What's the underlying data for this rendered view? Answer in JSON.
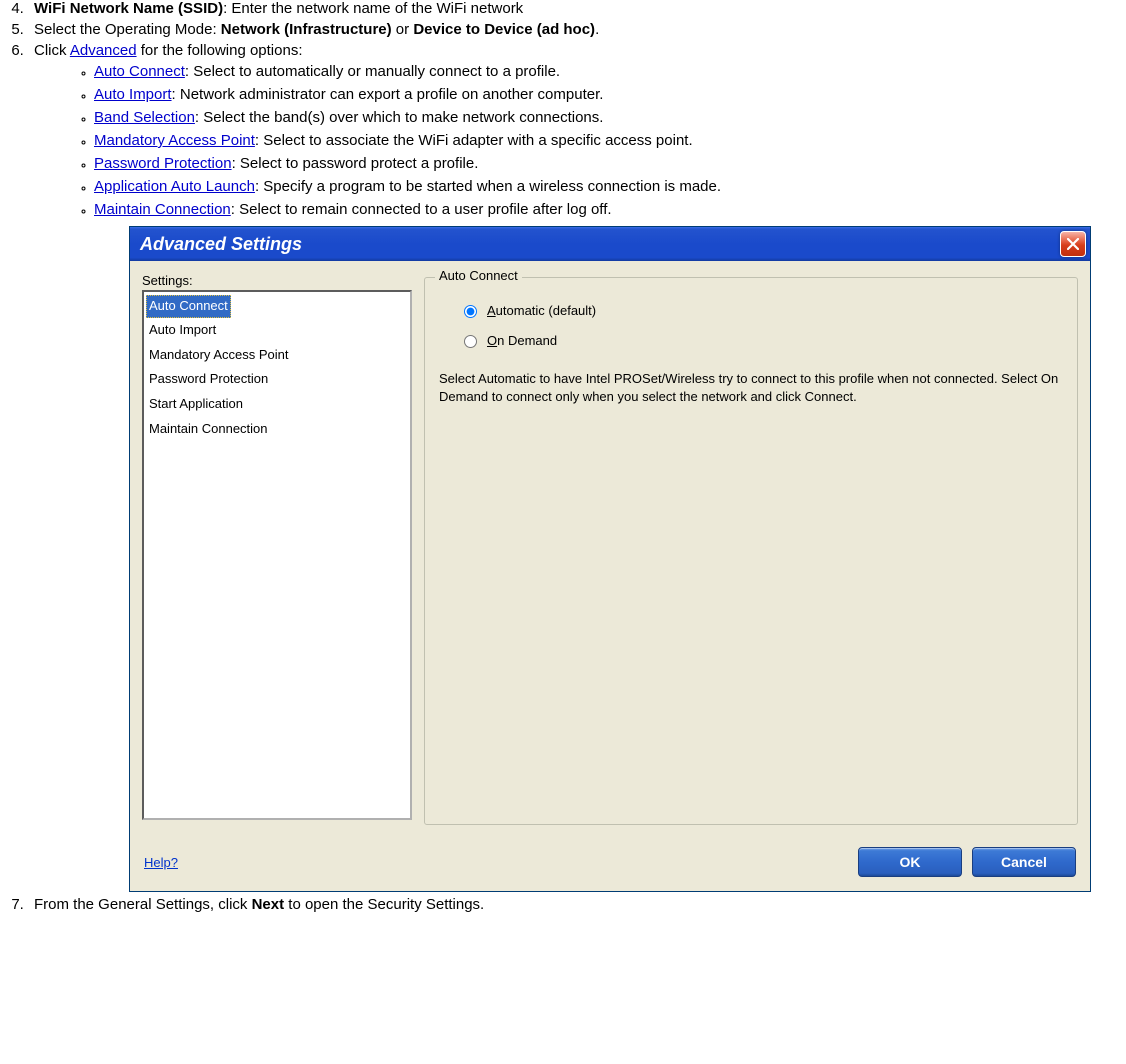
{
  "steps": {
    "s4": {
      "bold": "WiFi Network Name (SSID)",
      "rest": ": Enter the network name of the WiFi network"
    },
    "s5": {
      "pre": "Select the Operating Mode: ",
      "b1": "Network (Infrastructure)",
      "mid": " or ",
      "b2": "Device to Device (ad hoc)",
      "end": "."
    },
    "s6": {
      "pre": "Click ",
      "link": "Advanced",
      "post": " for the following options:"
    },
    "sub": {
      "a": {
        "link": "Auto Connect",
        "desc": ": Select to automatically or manually connect to a profile."
      },
      "b": {
        "link": "Auto Import",
        "desc": ": Network administrator can export a profile on another computer."
      },
      "c": {
        "link": "Band Selection",
        "desc": ": Select the band(s) over which to make network connections."
      },
      "d": {
        "link": "Mandatory Access Point",
        "desc": ": Select to associate the WiFi adapter with a specific access point."
      },
      "e": {
        "link": "Password Protection",
        "desc": ": Select to password protect a profile."
      },
      "f": {
        "link": "Application Auto Launch",
        "desc": ": Specify a program to be started when a wireless connection is made."
      },
      "g": {
        "link": "Maintain Connection",
        "desc": ": Select to remain connected to a user profile after log off."
      }
    },
    "s7": {
      "pre": "From the General Settings, click ",
      "bold": "Next",
      "post": " to open the Security Settings."
    }
  },
  "dialog": {
    "title": "Advanced Settings",
    "settings_label": "Settings:",
    "settings_items": [
      "Auto Connect",
      "Auto Import",
      "Mandatory Access Point",
      "Password Protection",
      "Start Application",
      "Maintain Connection"
    ],
    "group_title": "Auto Connect",
    "radio_auto_pre": "A",
    "radio_auto_rest": "utomatic (default)",
    "radio_demand_pre": "O",
    "radio_demand_rest": "n Demand",
    "desc": "Select Automatic to have Intel PROSet/Wireless try to connect to this profile when not connected. Select On Demand to connect only when you select the network and click Connect.",
    "help": "Help?",
    "ok": "OK",
    "cancel": "Cancel"
  }
}
